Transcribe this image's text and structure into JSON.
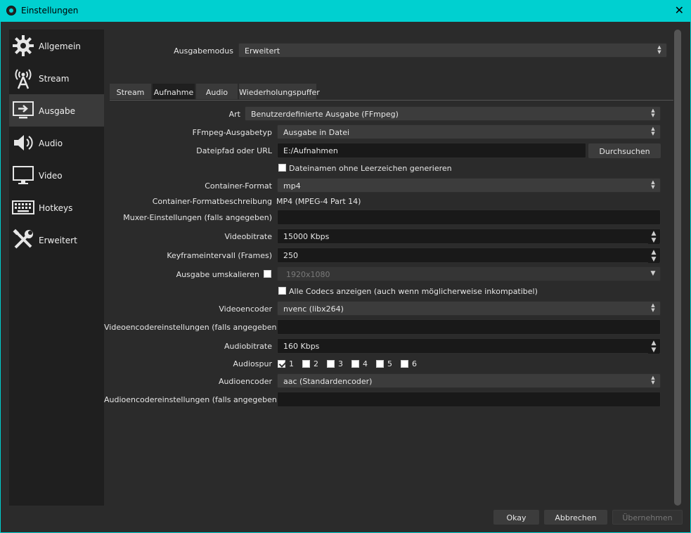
{
  "window": {
    "title": "Einstellungen",
    "close_glyph": "✕"
  },
  "sidebar": {
    "items": [
      {
        "label": "Allgemein",
        "icon": "gear-icon"
      },
      {
        "label": "Stream",
        "icon": "antenna-icon"
      },
      {
        "label": "Ausgabe",
        "icon": "output-icon"
      },
      {
        "label": "Audio",
        "icon": "speaker-icon"
      },
      {
        "label": "Video",
        "icon": "monitor-icon"
      },
      {
        "label": "Hotkeys",
        "icon": "keyboard-icon"
      },
      {
        "label": "Erweitert",
        "icon": "tools-icon"
      }
    ],
    "active": "Ausgabe"
  },
  "output_mode": {
    "label": "Ausgabemodus",
    "value": "Erweitert"
  },
  "tabs": [
    {
      "label": "Stream"
    },
    {
      "label": "Aufnahme"
    },
    {
      "label": "Audio"
    },
    {
      "label": "Wiederholungspuffer"
    }
  ],
  "recording": {
    "type": {
      "label": "Art",
      "value": "Benutzerdefinierte Ausgabe (FFmpeg)"
    },
    "ffmpeg_output_type": {
      "label": "FFmpeg-Ausgabetyp",
      "value": "Ausgabe in Datei"
    },
    "path": {
      "label": "Dateipfad oder URL",
      "value": "E:/Aufnahmen",
      "browse": "Durchsuchen"
    },
    "no_spaces": {
      "label": "Dateinamen ohne Leerzeichen generieren",
      "checked": false
    },
    "container_format": {
      "label": "Container-Format",
      "value": "mp4"
    },
    "container_desc": {
      "label": "Container-Formatbeschreibung",
      "value": "MP4 (MPEG-4 Part 14)"
    },
    "muxer": {
      "label": "Muxer-Einstellungen (falls angegeben)",
      "value": ""
    },
    "video_bitrate": {
      "label": "Videobitrate",
      "value": "15000 Kbps"
    },
    "keyframe": {
      "label": "Keyframeintervall (Frames)",
      "value": "250"
    },
    "rescale": {
      "label": "Ausgabe umskalieren",
      "checked": false,
      "value": "1920x1080"
    },
    "all_codecs": {
      "label": "Alle Codecs anzeigen (auch wenn möglicherweise inkompatibel)",
      "checked": false
    },
    "video_encoder": {
      "label": "Videoencoder",
      "value": "nvenc (libx264)"
    },
    "video_encoder_settings": {
      "label": "Videoencodereinstellungen (falls angegeben)",
      "value": ""
    },
    "audio_bitrate": {
      "label": "Audiobitrate",
      "value": "160 Kbps"
    },
    "audio_track": {
      "label": "Audiospur",
      "tracks": [
        {
          "label": "1",
          "checked": true
        },
        {
          "label": "2",
          "checked": false
        },
        {
          "label": "3",
          "checked": false
        },
        {
          "label": "4",
          "checked": false
        },
        {
          "label": "5",
          "checked": false
        },
        {
          "label": "6",
          "checked": false
        }
      ]
    },
    "audio_encoder": {
      "label": "Audioencoder",
      "value": "aac (Standardencoder)"
    },
    "audio_encoder_settings": {
      "label": "Audioencodereinstellungen (falls angegeben)",
      "value": ""
    }
  },
  "footer": {
    "ok": "Okay",
    "cancel": "Abbrechen",
    "apply": "Übernehmen"
  },
  "colors": {
    "accent": "#00d0d0",
    "background": "#2b2b2b",
    "sidebar": "#1f1f1f"
  }
}
